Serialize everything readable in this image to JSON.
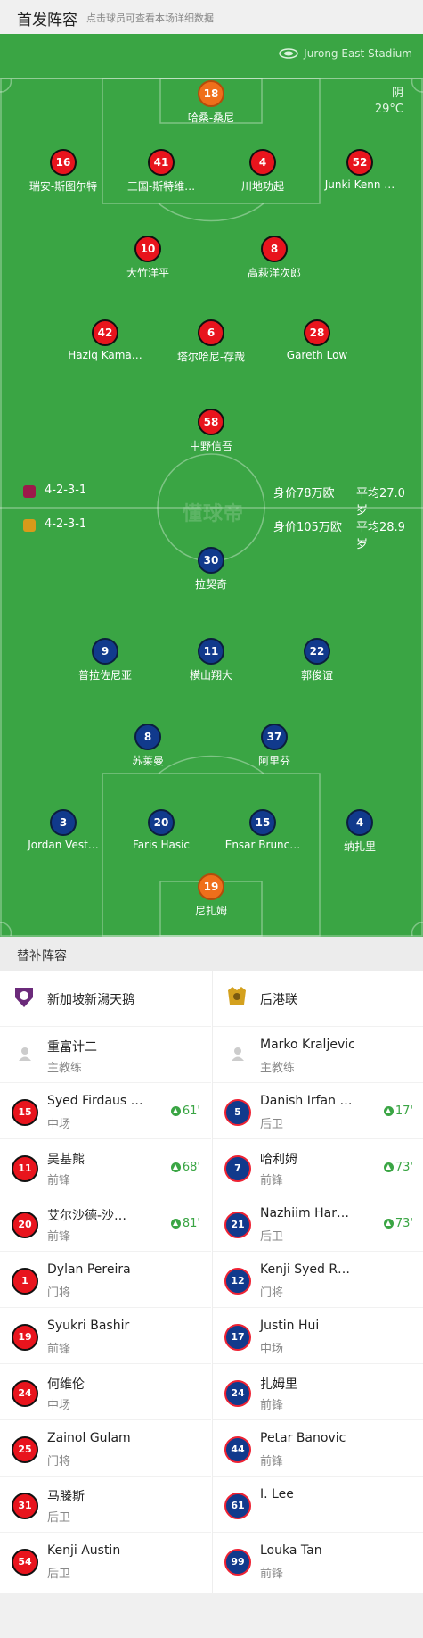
{
  "header": {
    "title": "首发阵容",
    "subtitle": "点击球员可查看本场详细数据"
  },
  "pitch": {
    "stadium": "Jurong East Stadium",
    "weather": "阴",
    "temperature": "29°C",
    "watermark": "懂球帝",
    "home_info": {
      "formation": "4-2-3-1",
      "value": "身价78万欧",
      "age": "平均27.0岁"
    },
    "away_info": {
      "formation": "4-2-3-1",
      "value": "身价105万欧",
      "age": "平均28.9岁"
    }
  },
  "home_players": [
    {
      "num": "18",
      "name": "哈桑-桑尼",
      "color": "orange",
      "yellow": true
    },
    {
      "num": "16",
      "name": "瑞安-斯图尔特",
      "color": "red",
      "yellow": true
    },
    {
      "num": "41",
      "name": "三国-斯特维…",
      "color": "red"
    },
    {
      "num": "4",
      "name": "川地功起",
      "color": "red"
    },
    {
      "num": "52",
      "name": "Junki Kenn …",
      "color": "red"
    },
    {
      "num": "10",
      "name": "大竹洋平",
      "color": "red",
      "goal": true
    },
    {
      "num": "8",
      "name": "高萩洋次郎",
      "color": "red"
    },
    {
      "num": "42",
      "name": "Haziq Kama…",
      "color": "red",
      "sub_off": "68'"
    },
    {
      "num": "6",
      "name": "塔尔哈尼-存哉",
      "color": "red",
      "sub_off": "81'"
    },
    {
      "num": "28",
      "name": "Gareth Low",
      "color": "red",
      "sub_off": "61'"
    },
    {
      "num": "58",
      "name": "中野信吾",
      "color": "red",
      "goal": true
    }
  ],
  "away_players": [
    {
      "num": "30",
      "name": "拉契奇",
      "color": "blue",
      "yellow": true
    },
    {
      "num": "9",
      "name": "普拉佐尼亚",
      "color": "blue",
      "yellow": true,
      "goal": true
    },
    {
      "num": "11",
      "name": "横山翔大",
      "color": "blue",
      "yellow": true
    },
    {
      "num": "22",
      "name": "郭俊谊",
      "color": "blue",
      "sub_off": "73'"
    },
    {
      "num": "8",
      "name": "苏莱曼",
      "color": "blue"
    },
    {
      "num": "37",
      "name": "阿里芬",
      "color": "blue"
    },
    {
      "num": "3",
      "name": "Jordan Vest…",
      "color": "blue",
      "yellow": true,
      "sub_off": "73'"
    },
    {
      "num": "20",
      "name": "Faris Hasic",
      "color": "blue",
      "sub_off": "17'"
    },
    {
      "num": "15",
      "name": "Ensar Brunc…",
      "color": "blue",
      "yellow": true
    },
    {
      "num": "4",
      "name": "纳扎里",
      "color": "blue"
    },
    {
      "num": "19",
      "name": "尼扎姆",
      "color": "orange"
    }
  ],
  "substitutes": {
    "title": "替补阵容",
    "home": {
      "team": "新加坡新潟天鹅",
      "coach": {
        "name": "重富计二",
        "role": "主教练"
      },
      "players": [
        {
          "num": "15",
          "name": "Syed Firdaus …",
          "pos": "中场",
          "minute": "61'"
        },
        {
          "num": "11",
          "name": "吴基熊",
          "pos": "前锋",
          "minute": "68'"
        },
        {
          "num": "20",
          "name": "艾尔沙德-沙…",
          "pos": "前锋",
          "minute": "81'"
        },
        {
          "num": "1",
          "name": "Dylan Pereira",
          "pos": "门将"
        },
        {
          "num": "19",
          "name": "Syukri Bashir",
          "pos": "前锋"
        },
        {
          "num": "24",
          "name": "何维伦",
          "pos": "中场"
        },
        {
          "num": "25",
          "name": "Zainol Gulam",
          "pos": "门将"
        },
        {
          "num": "31",
          "name": "马滕斯",
          "pos": "后卫"
        },
        {
          "num": "54",
          "name": "Kenji Austin",
          "pos": "后卫"
        }
      ]
    },
    "away": {
      "team": "后港联",
      "coach": {
        "name": "Marko Kraljevic",
        "role": "主教练"
      },
      "players": [
        {
          "num": "5",
          "name": "Danish Irfan …",
          "pos": "后卫",
          "minute": "17'"
        },
        {
          "num": "7",
          "name": "哈利姆",
          "pos": "前锋",
          "minute": "73'"
        },
        {
          "num": "21",
          "name": "Nazhiim Har…",
          "pos": "后卫",
          "minute": "73'"
        },
        {
          "num": "12",
          "name": "Kenji Syed R…",
          "pos": "门将"
        },
        {
          "num": "17",
          "name": "Justin Hui",
          "pos": "中场"
        },
        {
          "num": "24",
          "name": "扎姆里",
          "pos": "前锋"
        },
        {
          "num": "44",
          "name": "Petar Banovic",
          "pos": "前锋"
        },
        {
          "num": "61",
          "name": "I. Lee",
          "pos": ""
        },
        {
          "num": "99",
          "name": "Louka Tan",
          "pos": "前锋"
        }
      ]
    }
  }
}
